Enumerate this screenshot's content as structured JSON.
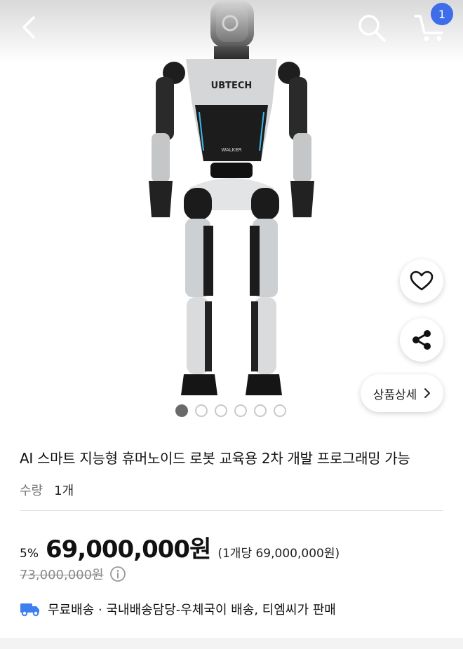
{
  "header": {
    "back_icon": "chevron-left-icon",
    "search_icon": "search-icon",
    "cart_icon": "cart-icon",
    "cart_count": "1"
  },
  "product_image": {
    "brand_mark": "UBTECH",
    "model_mark": "WALKER",
    "image_count": 6,
    "active_index": 0
  },
  "actions": {
    "like_icon": "heart-icon",
    "share_icon": "share-icon",
    "detail_label": "상품상세",
    "detail_icon": "chevron-right-icon"
  },
  "product": {
    "title": "AI 스마트 지능형 휴머노이드 로봇 교육용 2차 개발 프로그래밍 가능",
    "qty_label": "수량",
    "qty_value": "1개",
    "discount": "5%",
    "price": "69,000,000원",
    "unit_price": "(1개당 69,000,000원)",
    "original_price": "73,000,000원",
    "shipping": "무료배송 · 국내배송담당-우체국이 배송, 티엠씨가 판매"
  },
  "colors": {
    "badge": "#3e6de9",
    "truck": "#3e7ef0"
  }
}
